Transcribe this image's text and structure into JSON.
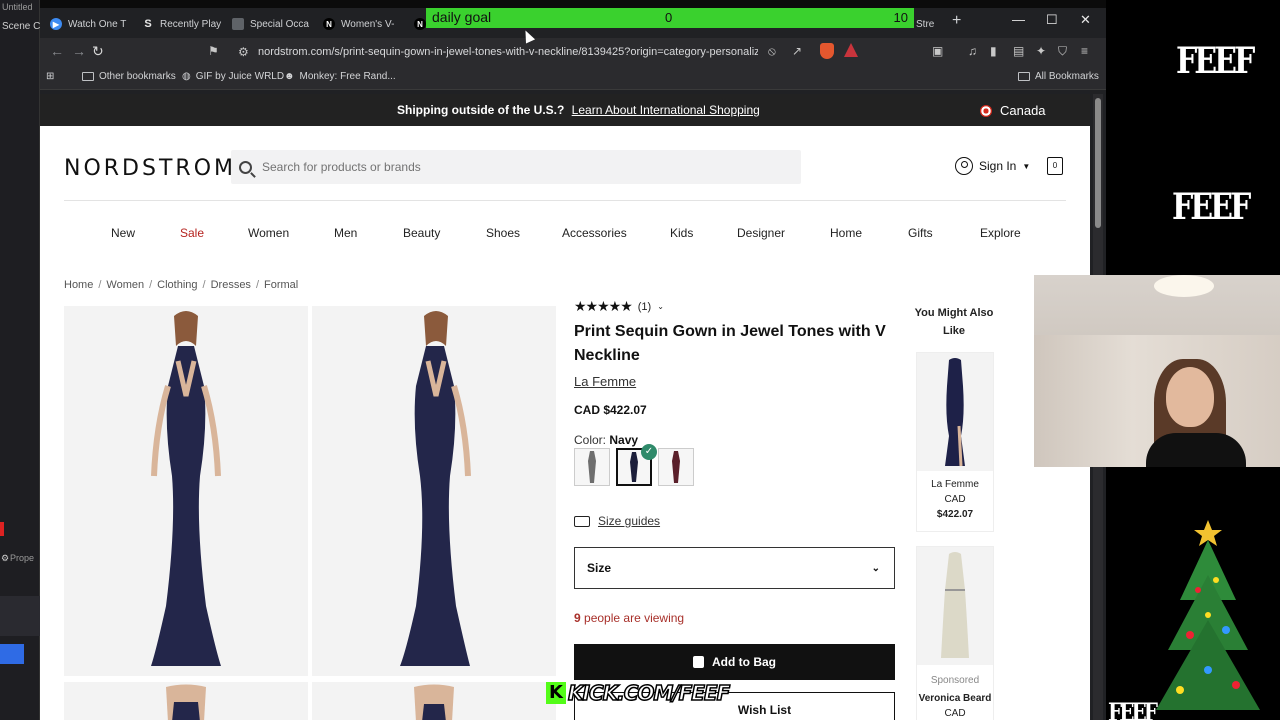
{
  "obs": {
    "title": "Untitled",
    "scene": "Scene C",
    "props": "Prope"
  },
  "tabs": [
    {
      "label": "Watch One T",
      "icon": "play-icon",
      "color": "#3d8bf2"
    },
    {
      "label": "Recently Play",
      "icon": "s-logo-icon",
      "color": "#202124"
    },
    {
      "label": "Special Occa",
      "icon": "image-icon",
      "color": "#5f6368"
    },
    {
      "label": "Women's V-",
      "icon": "nordstrom-n-icon",
      "color": "#000000"
    },
    {
      "label": "N",
      "icon": "nordstrom-n-icon",
      "color": "#000000"
    },
    {
      "label": "Stre",
      "icon": "",
      "color": ""
    }
  ],
  "address": {
    "url": "nordstrom.com/s/print-sequin-gown-in-jewel-tones-with-v-neckline/8139425?origin=category-personaliz..."
  },
  "bookmarks": [
    "Other bookmarks",
    "GIF by Juice WRLD",
    "Monkey: Free Rand...",
    "All Bookmarks"
  ],
  "shipping": {
    "text": "Shipping outside of the U.S.?",
    "link": "Learn About International Shopping",
    "country": "Canada"
  },
  "header": {
    "logo": "NORDSTROM",
    "search_placeholder": "Search for products or brands",
    "signin": "Sign In",
    "bag_count": "0"
  },
  "nav": [
    "New",
    "Sale",
    "Women",
    "Men",
    "Beauty",
    "Shoes",
    "Accessories",
    "Kids",
    "Designer",
    "Home",
    "Gifts",
    "Explore"
  ],
  "breadcrumbs": [
    "Home",
    "Women",
    "Clothing",
    "Dresses",
    "Formal"
  ],
  "product": {
    "stars": "★★★★★",
    "review_count": "(1)",
    "title": "Print Sequin Gown in Jewel Tones with V Neckline",
    "brand": "La Femme",
    "price": "CAD $422.07",
    "color_label": "Color:",
    "color_value": "Navy",
    "size_guides": "Size guides",
    "size_label": "Size",
    "viewing_count": "9",
    "viewing_text": "people are viewing",
    "add_to_bag": "Add to Bag",
    "wish_list": "Wish List"
  },
  "recommendations": {
    "title": "You Might Also Like",
    "items": [
      {
        "brand": "La Femme",
        "currency": "CAD",
        "price": "$422.07",
        "sponsored": ""
      },
      {
        "brand": "Veronica Beard",
        "currency": "CAD",
        "price": "",
        "sponsored": "Sponsored"
      }
    ]
  },
  "stream": {
    "goal_label": "daily goal",
    "goal_current": "0",
    "goal_max": "10",
    "goal_progress": 0,
    "brand_text": "FEEF",
    "kick": "KICK.COM/FEEF"
  },
  "colors": {
    "goal": "#3ad12e",
    "kick": "#53fc18",
    "sale": "#b5231f",
    "viewing": "#a8302a"
  }
}
